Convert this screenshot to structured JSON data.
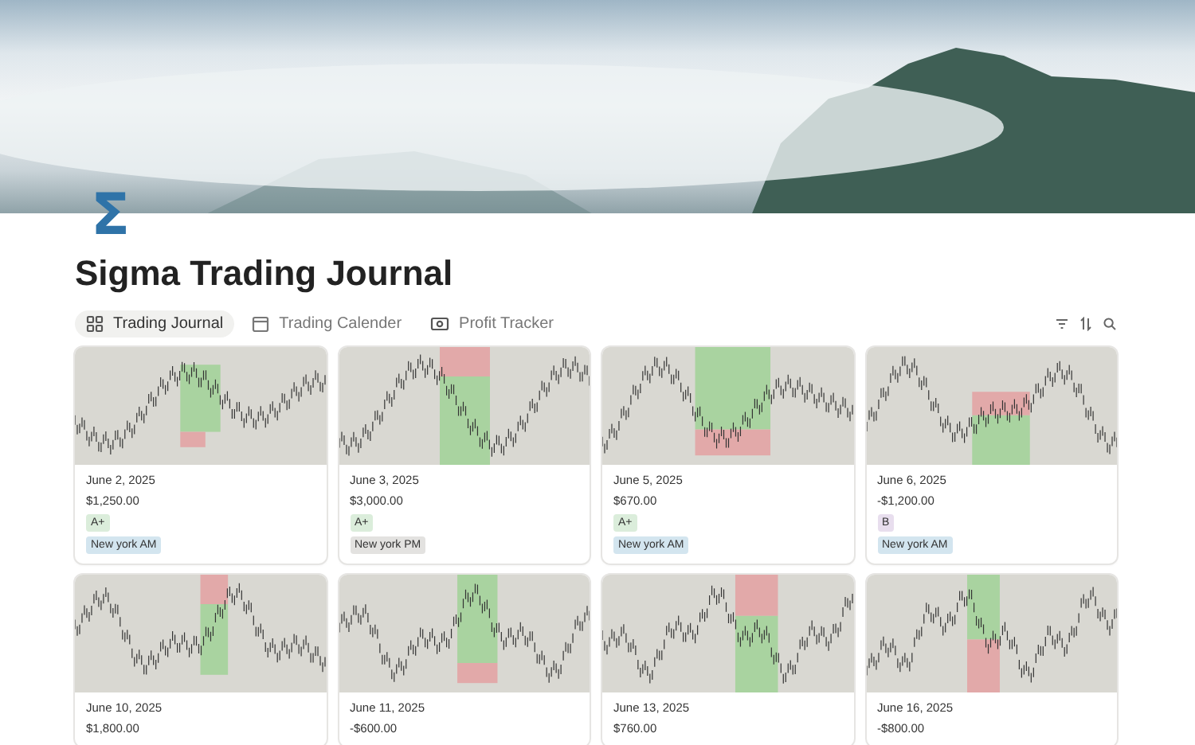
{
  "page": {
    "icon": "Σ",
    "title": "Sigma Trading Journal"
  },
  "tabs": [
    {
      "label": "Trading Journal",
      "selected": true
    },
    {
      "label": "Trading Calender",
      "selected": false
    },
    {
      "label": "Profit Tracker",
      "selected": false
    }
  ],
  "cards": [
    {
      "date": "June 2, 2025",
      "amount": "$1,250.00",
      "tags": [
        {
          "label": "A+",
          "color": "#dbeddb"
        },
        {
          "label": "New york AM",
          "color": "#d3e5ef"
        }
      ]
    },
    {
      "date": "June 3, 2025",
      "amount": "$3,000.00",
      "tags": [
        {
          "label": "A+",
          "color": "#dbeddb"
        },
        {
          "label": "New york PM",
          "color": "#e3e2e0"
        }
      ]
    },
    {
      "date": "June 5, 2025",
      "amount": "$670.00",
      "tags": [
        {
          "label": "A+",
          "color": "#dbeddb"
        },
        {
          "label": "New york AM",
          "color": "#d3e5ef"
        }
      ]
    },
    {
      "date": "June 6, 2025",
      "amount": "-$1,200.00",
      "tags": [
        {
          "label": "B",
          "color": "#e8deee"
        },
        {
          "label": "New york AM",
          "color": "#d3e5ef"
        }
      ]
    },
    {
      "date": "June 10, 2025",
      "amount": "$1,800.00"
    },
    {
      "date": "June 11, 2025",
      "amount": "-$600.00"
    },
    {
      "date": "June 13, 2025",
      "amount": "$760.00"
    },
    {
      "date": "June 16, 2025",
      "amount": "-$800.00"
    }
  ]
}
